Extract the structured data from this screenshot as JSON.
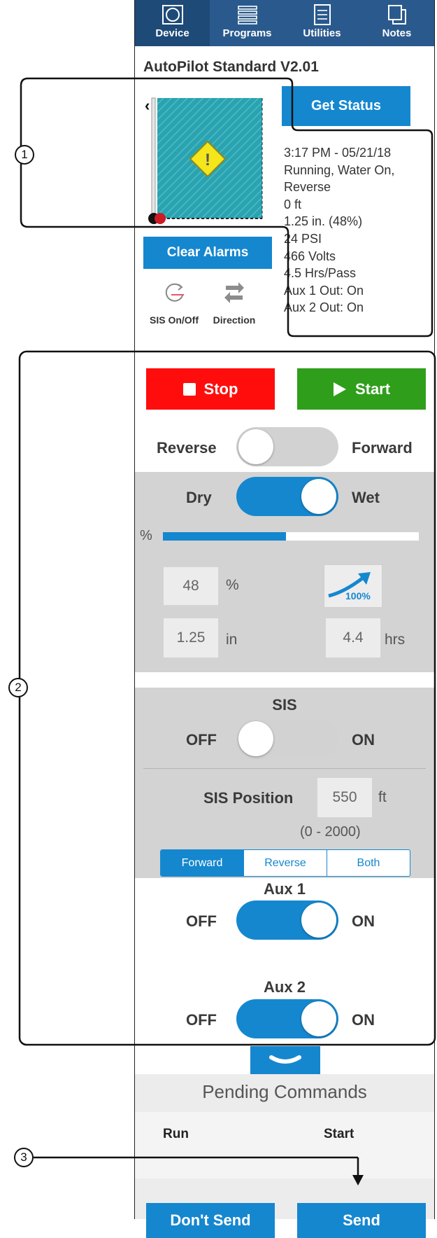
{
  "tabs": [
    {
      "label": "Device",
      "icon": "device-icon",
      "active": true
    },
    {
      "label": "Programs",
      "icon": "programs-icon",
      "active": false
    },
    {
      "label": "Utilities",
      "icon": "utilities-icon",
      "active": false
    },
    {
      "label": "Notes",
      "icon": "notes-icon",
      "active": false
    }
  ],
  "device_title": "AutoPilot Standard V2.01",
  "get_status_label": "Get Status",
  "status_lines": [
    "3:17 PM - 05/21/18",
    "Running, Water On,",
    "Reverse",
    "0 ft",
    "1.25 in. (48%)",
    "24  PSI",
    "466 Volts",
    "4.5 Hrs/Pass",
    "Aux 1 Out: On",
    "Aux 2 Out: On"
  ],
  "clear_alarms_label": "Clear Alarms",
  "sis_onoff_label": "SIS On/Off",
  "direction_label": "Direction",
  "stop_label": "Stop",
  "start_label": "Start",
  "direction_toggle": {
    "left": "Reverse",
    "right": "Forward",
    "on": false
  },
  "wet_toggle": {
    "left": "Dry",
    "right": "Wet",
    "on": true
  },
  "percent_symbol": "%",
  "percent_bar_fill": 0.48,
  "percent_value": "48",
  "percent_unit": "%",
  "depth_value": "1.25",
  "depth_unit": "in",
  "hours_value": "4.4",
  "hours_unit": "hrs",
  "speed_button_label": "100%",
  "sis": {
    "title": "SIS",
    "off": "OFF",
    "on": "ON",
    "enabled": false
  },
  "sis_position": {
    "label": "SIS Position",
    "value": "550",
    "unit": "ft",
    "range": "(0 - 2000)"
  },
  "sis_direction_options": [
    "Forward",
    "Reverse",
    "Both"
  ],
  "sis_direction_selected": "Forward",
  "aux1": {
    "title": "Aux 1",
    "off": "OFF",
    "on": "ON",
    "enabled": true
  },
  "aux2": {
    "title": "Aux 2",
    "off": "OFF",
    "on": "ON",
    "enabled": true
  },
  "pending": {
    "title": "Pending Commands",
    "command": "Run",
    "value": "Start"
  },
  "dont_send_label": "Don't Send",
  "send_label": "Send",
  "callouts": [
    "1",
    "2",
    "3"
  ],
  "colors": {
    "accent": "#1587cf",
    "stop": "#ff0d0d",
    "start": "#2f9e1b",
    "tabbar": "#2a5a8d",
    "panel_gray": "#d3d3d3"
  }
}
